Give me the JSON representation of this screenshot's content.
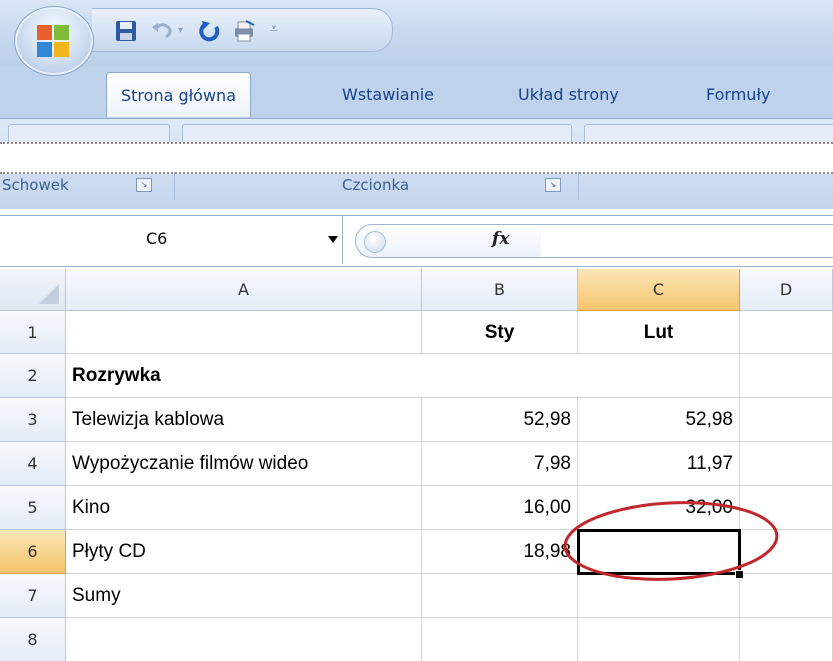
{
  "quick_access": {
    "icons": [
      "office-logo",
      "save-icon",
      "undo-icon",
      "redo-icon",
      "print-icon",
      "customize-icon"
    ]
  },
  "ribbon": {
    "tabs": [
      {
        "label": "Strona główna",
        "active": true
      },
      {
        "label": "Wstawianie",
        "active": false
      },
      {
        "label": "Układ strony",
        "active": false
      },
      {
        "label": "Formuły",
        "active": false
      }
    ],
    "groups": [
      {
        "label": "Schowek"
      },
      {
        "label": "Czcionka"
      }
    ]
  },
  "formula_bar": {
    "name_box": "C6",
    "fx_label": "fx",
    "formula": ""
  },
  "sheet": {
    "columns": [
      "A",
      "B",
      "C",
      "D"
    ],
    "selected_column": "C",
    "rows": [
      {
        "num": "1",
        "a": "",
        "b": "Sty",
        "c": "Lut"
      },
      {
        "num": "2",
        "a": "Rozrywka",
        "b": "",
        "c": ""
      },
      {
        "num": "3",
        "a": "Telewizja kablowa",
        "b": "52,98",
        "c": "52,98"
      },
      {
        "num": "4",
        "a": "Wypożyczanie filmów wideo",
        "b": "7,98",
        "c": "11,97"
      },
      {
        "num": "5",
        "a": "Kino",
        "b": "16,00",
        "c": "32,00"
      },
      {
        "num": "6",
        "a": "Płyty CD",
        "b": "18,98",
        "c": ""
      },
      {
        "num": "7",
        "a": "Sumy",
        "b": "",
        "c": ""
      },
      {
        "num": "8",
        "a": "",
        "b": "",
        "c": ""
      }
    ],
    "selected_row": "6",
    "active_cell": "C6"
  },
  "colors": {
    "selection_header": "#f5c56e",
    "annotation_ellipse": "#c0282d",
    "ribbon_text": "#15428b"
  }
}
